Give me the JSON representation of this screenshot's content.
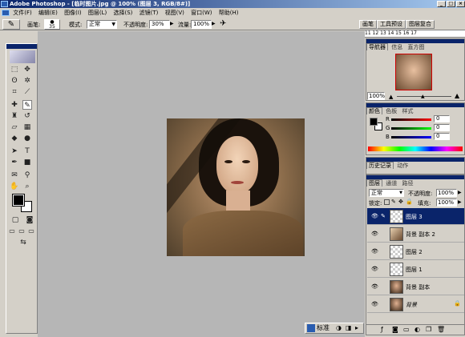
{
  "window": {
    "title": "Adobe Photoshop - [临时图片.jpg @ 100% (图层 3, RGB/8#)]",
    "min_icon": "minimize-icon",
    "max_icon": "maximize-icon",
    "close_icon": "close-icon"
  },
  "menu": {
    "items": [
      "文件(F)",
      "编辑(E)",
      "图像(I)",
      "图层(L)",
      "选择(S)",
      "滤镜(T)",
      "视图(V)",
      "窗口(W)",
      "帮助(H)"
    ]
  },
  "options": {
    "brush_label": "画笔:",
    "brush_size": "35",
    "mode_label": "模式:",
    "mode_value": "正常",
    "opacity_label": "不透明度:",
    "opacity_value": "30%",
    "flow_label": "流量:",
    "flow_value": "100%"
  },
  "palette_well": {
    "tabs": [
      "画笔",
      "工具预设",
      "图层复合"
    ]
  },
  "ruler": {
    "ticks": "11  12  13  14  15  16  17"
  },
  "navigator": {
    "tabs": [
      "导航器",
      "信息",
      "直方图"
    ],
    "zoom": "100%"
  },
  "color": {
    "tabs": [
      "颜色",
      "色板",
      "样式"
    ],
    "channels": [
      {
        "label": "R",
        "value": "0",
        "color": "#c00000"
      },
      {
        "label": "G",
        "value": "0",
        "color": "#008000"
      },
      {
        "label": "B",
        "value": "0",
        "color": "#0000c0"
      }
    ]
  },
  "history": {
    "tabs": [
      "历史记录",
      "动作"
    ]
  },
  "layers": {
    "tabs": [
      "图层",
      "通道",
      "路径"
    ],
    "blend_mode": "正常",
    "opacity_label": "不透明度:",
    "opacity_value": "100%",
    "lock_label": "锁定:",
    "fill_label": "填充:",
    "fill_value": "100%",
    "rows": [
      {
        "name": "图层 3",
        "selected": true
      },
      {
        "name": "背景 副本 2",
        "selected": false
      },
      {
        "name": "图层 2",
        "selected": false
      },
      {
        "name": "图层 1",
        "selected": false
      },
      {
        "name": "背景 副本",
        "selected": false
      },
      {
        "name": "背景",
        "selected": false
      }
    ]
  },
  "status": {
    "mode_label": "标准"
  }
}
